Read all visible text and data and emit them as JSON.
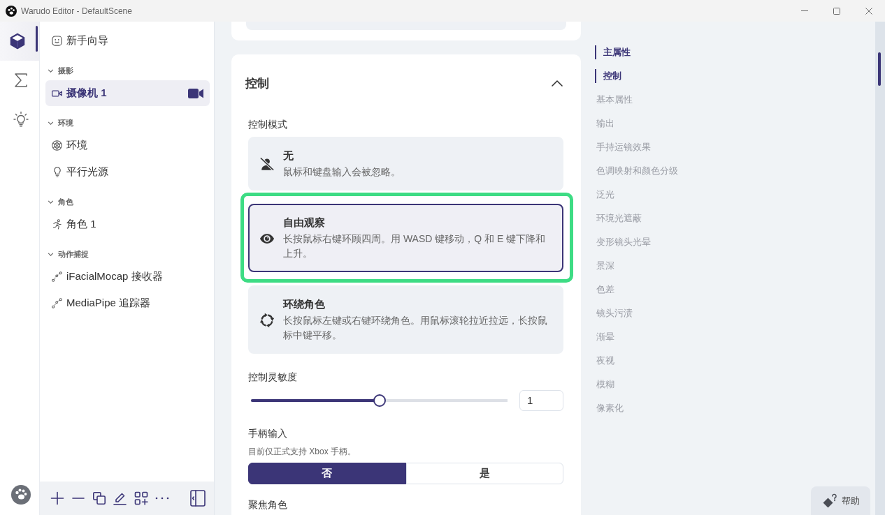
{
  "window": {
    "title": "Warudo Editor - DefaultScene"
  },
  "activity_bar": {
    "items": [
      {
        "kind": "cube",
        "selected": true
      },
      {
        "kind": "sigma",
        "selected": false
      },
      {
        "kind": "bulb",
        "selected": false
      }
    ]
  },
  "sidebar": {
    "top_item": {
      "label": "新手向导"
    },
    "groups": [
      {
        "label": "摄影",
        "expanded": true,
        "items": [
          {
            "kind": "camera",
            "label": "摄像机 1",
            "selected": true,
            "active": true
          }
        ]
      },
      {
        "label": "环境",
        "expanded": true,
        "items": [
          {
            "kind": "environment",
            "label": "环境",
            "selected": false,
            "active": false
          },
          {
            "kind": "light",
            "label": "平行光源",
            "selected": false,
            "active": false
          }
        ]
      },
      {
        "label": "角色",
        "expanded": true,
        "items": [
          {
            "kind": "character",
            "label": "角色 1",
            "selected": false,
            "active": false
          }
        ]
      },
      {
        "label": "动作捕捉",
        "expanded": true,
        "items": [
          {
            "kind": "mocap",
            "label": "iFacialMocap 接收器",
            "selected": false,
            "active": false
          },
          {
            "kind": "mocap",
            "label": "MediaPipe 追踪器",
            "selected": false,
            "active": false
          }
        ]
      }
    ]
  },
  "control_card": {
    "title": "控制",
    "expanded": true,
    "mode": {
      "label": "控制模式",
      "options": [
        {
          "kind": "none",
          "title": "无",
          "description": "鼠标和键盘输入会被忽略。",
          "selected": false,
          "highlighted": false
        },
        {
          "kind": "look",
          "title": "自由观察",
          "description": "长按鼠标右键环顾四周。用 WASD 键移动，Q 和 E 键下降和上升。",
          "selected": true,
          "highlighted": true
        },
        {
          "kind": "orbit",
          "title": "环绕角色",
          "description": "长按鼠标左键或右键环绕角色。用鼠标滚轮拉近拉远，长按鼠标中键平移。",
          "selected": false,
          "highlighted": false
        }
      ]
    },
    "sensitivity": {
      "label": "控制灵敏度",
      "level": 0.5,
      "value": "1"
    },
    "gamepad": {
      "label": "手柄输入",
      "hint": "目前仅正式支持 Xbox 手柄。",
      "choices": [
        {
          "label": "否",
          "selected": true
        },
        {
          "label": "是",
          "selected": false
        }
      ]
    },
    "next_label": "聚焦角色"
  },
  "outline": {
    "items": [
      {
        "label": "主属性",
        "selected": true
      },
      {
        "label": "控制",
        "selected": true
      },
      {
        "label": "基本属性",
        "selected": false
      },
      {
        "label": "输出",
        "selected": false
      },
      {
        "label": "手持运镜效果",
        "selected": false
      },
      {
        "label": "色调映射和颜色分级",
        "selected": false
      },
      {
        "label": "泛光",
        "selected": false
      },
      {
        "label": "环境光遮蔽",
        "selected": false
      },
      {
        "label": "变形镜头光晕",
        "selected": false
      },
      {
        "label": "景深",
        "selected": false
      },
      {
        "label": "色差",
        "selected": false
      },
      {
        "label": "镜头污渍",
        "selected": false
      },
      {
        "label": "渐晕",
        "selected": false
      },
      {
        "label": "夜视",
        "selected": false
      },
      {
        "label": "模糊",
        "selected": false
      },
      {
        "label": "像素化",
        "selected": false
      }
    ]
  },
  "help_button": {
    "label": "帮助"
  }
}
